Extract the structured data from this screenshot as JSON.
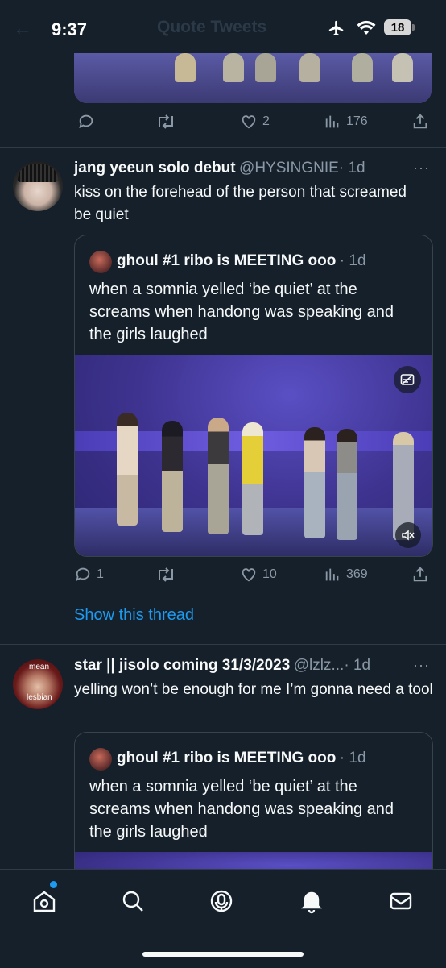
{
  "status_bar": {
    "time": "9:37",
    "battery": "18",
    "ghost_title": "Quote Tweets",
    "ghost_back": "←"
  },
  "top_tweet": {
    "actions": {
      "replies": "",
      "retweets": "",
      "likes": "2",
      "views": "176"
    }
  },
  "tweet1": {
    "display_name": "jang yeeun solo debut",
    "handle": "@HYSINGNIE",
    "time": "· 1d",
    "more": "···",
    "text": "kiss on the forehead of the person that screamed be quiet",
    "quote": {
      "display_name": "ghoul #1 ribo is MEETING ooo",
      "time": "· 1d",
      "text": "when a somnia yelled ‘be quiet’ at the screams when handong was speaking and the girls laughed"
    },
    "actions": {
      "replies": "1",
      "retweets": "",
      "likes": "10",
      "views": "369"
    },
    "show_thread": "Show this thread"
  },
  "tweet2": {
    "display_name": "star || jisolo coming 31/3/2023",
    "handle": "@lzlz...",
    "time": "· 1d",
    "more": "···",
    "avatar_text_top": "mean",
    "avatar_text_bottom": "lesbian",
    "text": "yelling won’t be enough for me I’m gonna need a tool",
    "quote": {
      "display_name": "ghoul #1 ribo is MEETING ooo",
      "time": "· 1d",
      "text": "when a somnia yelled ‘be quiet’ at the screams when handong was speaking and the girls laughed"
    }
  },
  "bottom_nav": {
    "items": [
      "home-icon",
      "search-icon",
      "spaces-icon",
      "notifications-icon",
      "messages-icon"
    ],
    "active": "home-icon",
    "accent": "#1d9bf0"
  },
  "colors": {
    "background": "#15202b",
    "text": "#f7f9f9",
    "muted": "#8b98a5",
    "link": "#1d9bf0",
    "border": "#38444d"
  }
}
